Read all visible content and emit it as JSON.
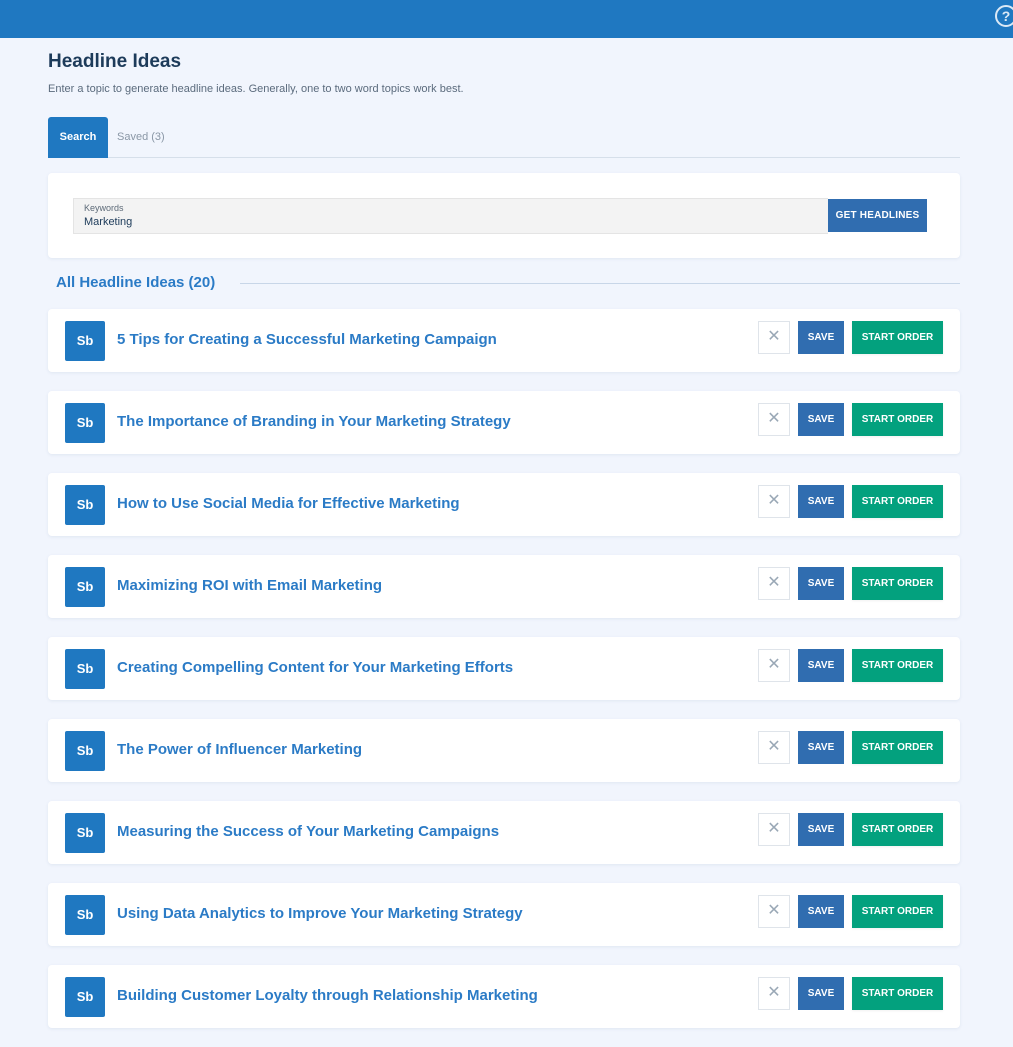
{
  "header": {
    "help_icon": "question-circle-icon",
    "help_glyph": "?"
  },
  "page": {
    "title": "Headline Ideas",
    "subtitle": "Enter a topic to generate headline ideas. Generally, one to two word topics work best."
  },
  "tabs": [
    {
      "label": "Search",
      "active": true
    },
    {
      "label": "Saved (3)",
      "active": false
    }
  ],
  "search": {
    "label": "Keywords",
    "value": "Marketing",
    "button_label": "GET HEADLINES"
  },
  "results": {
    "title": "All Headline Ideas (20)",
    "badge": "Sb",
    "dismiss_glyph": "✕",
    "save_label": "SAVE",
    "order_label": "START ORDER",
    "items": [
      {
        "headline": "5 Tips for Creating a Successful Marketing Campaign"
      },
      {
        "headline": "The Importance of Branding in Your Marketing Strategy"
      },
      {
        "headline": "How to Use Social Media for Effective Marketing"
      },
      {
        "headline": "Maximizing ROI with Email Marketing"
      },
      {
        "headline": "Creating Compelling Content for Your Marketing Efforts"
      },
      {
        "headline": "The Power of Influencer Marketing"
      },
      {
        "headline": "Measuring the Success of Your Marketing Campaigns"
      },
      {
        "headline": "Using Data Analytics to Improve Your Marketing Strategy"
      },
      {
        "headline": "Building Customer Loyalty through Relationship Marketing"
      }
    ]
  },
  "colors": {
    "brand_blue": "#1f78c1",
    "button_blue": "#306db0",
    "order_green": "#03a17e",
    "background": "#f1f5fd"
  }
}
